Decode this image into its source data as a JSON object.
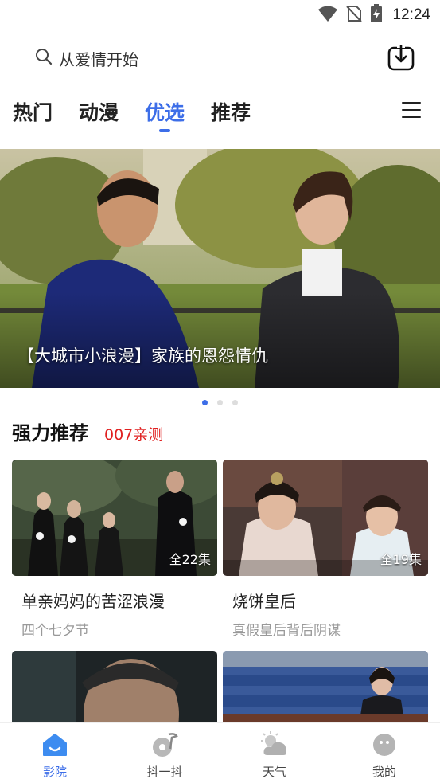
{
  "status_bar": {
    "time": "12:24",
    "icons": [
      "wifi-icon",
      "no-sim-icon",
      "battery-charging-icon"
    ]
  },
  "search": {
    "placeholder": "从爱情开始",
    "icon": "search-icon",
    "download_icon": "download-icon"
  },
  "tabs": [
    {
      "label": "热门",
      "active": false
    },
    {
      "label": "动漫",
      "active": false
    },
    {
      "label": "优选",
      "active": true
    },
    {
      "label": "推荐",
      "active": false
    }
  ],
  "menu_icon": "hamburger-menu-icon",
  "banner": {
    "caption": "【大城市小浪漫】家族的恩怨情仇",
    "page_count": 3,
    "active_page": 1
  },
  "section": {
    "title": "强力推荐",
    "tag": "007亲测"
  },
  "cards": [
    {
      "title": "单亲妈妈的苦涩浪漫",
      "subtitle": "四个七夕节",
      "badge": "全22集"
    },
    {
      "title": "烧饼皇后",
      "subtitle": "真假皇后背后阴谋",
      "badge": "全19集"
    }
  ],
  "bottom_nav": [
    {
      "label": "影院",
      "icon": "cinema-home-icon",
      "active": true
    },
    {
      "label": "抖一抖",
      "icon": "music-note-icon",
      "active": false
    },
    {
      "label": "天气",
      "icon": "weather-cloud-icon",
      "active": false
    },
    {
      "label": "我的",
      "icon": "profile-icon",
      "active": false
    }
  ],
  "colors": {
    "accent": "#3d6ee8",
    "tag_red": "#e02020",
    "subtitle_gray": "#999999"
  }
}
